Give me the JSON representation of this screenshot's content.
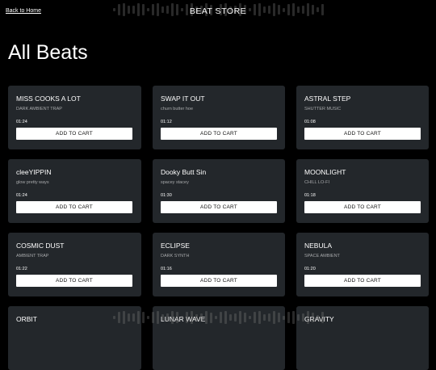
{
  "header": {
    "back_link": "Back to Home",
    "site_title": "BEAT STORE"
  },
  "page_title": "All Beats",
  "beats": [
    {
      "title": "MISS COOKS A LOT",
      "genre": "DARK AMBIENT TRAP",
      "duration": "01:24",
      "button": "ADD TO CART"
    },
    {
      "title": "SWAP IT OUT",
      "genre": "churn butter hoe",
      "duration": "01:12",
      "button": "ADD TO CART"
    },
    {
      "title": "ASTRAL STEP",
      "genre": "SHUTTER MUSIC",
      "duration": "01:08",
      "button": "ADD TO CART"
    },
    {
      "title": "cleeYIPPIN",
      "genre": "glow pretty ways",
      "duration": "01:24",
      "button": "ADD TO CART"
    },
    {
      "title": "Dooky Butt Sin",
      "genre": "spacey stacey",
      "duration": "01:30",
      "button": "ADD TO CART"
    },
    {
      "title": "MOONLIGHT",
      "genre": "CHILL LO-FI",
      "duration": "01:18",
      "button": "ADD TO CART"
    },
    {
      "title": "COSMIC DUST",
      "genre": "AMBIENT TRAP",
      "duration": "01:22",
      "button": "ADD TO CART"
    },
    {
      "title": "ECLIPSE",
      "genre": "DARK SYNTH",
      "duration": "01:16",
      "button": "ADD TO CART"
    },
    {
      "title": "NEBULA",
      "genre": "SPACE AMBIENT",
      "duration": "01:20",
      "button": "ADD TO CART"
    },
    {
      "title": "ORBIT",
      "genre": "",
      "duration": "",
      "button": ""
    },
    {
      "title": "LUNAR WAVE",
      "genre": "",
      "duration": "",
      "button": ""
    },
    {
      "title": "GRAVITY",
      "genre": "",
      "duration": "",
      "button": ""
    }
  ],
  "colors": {
    "background": "#000000",
    "card": "#23272b",
    "button": "#ffffff",
    "subtext": "#a7a9ab"
  }
}
